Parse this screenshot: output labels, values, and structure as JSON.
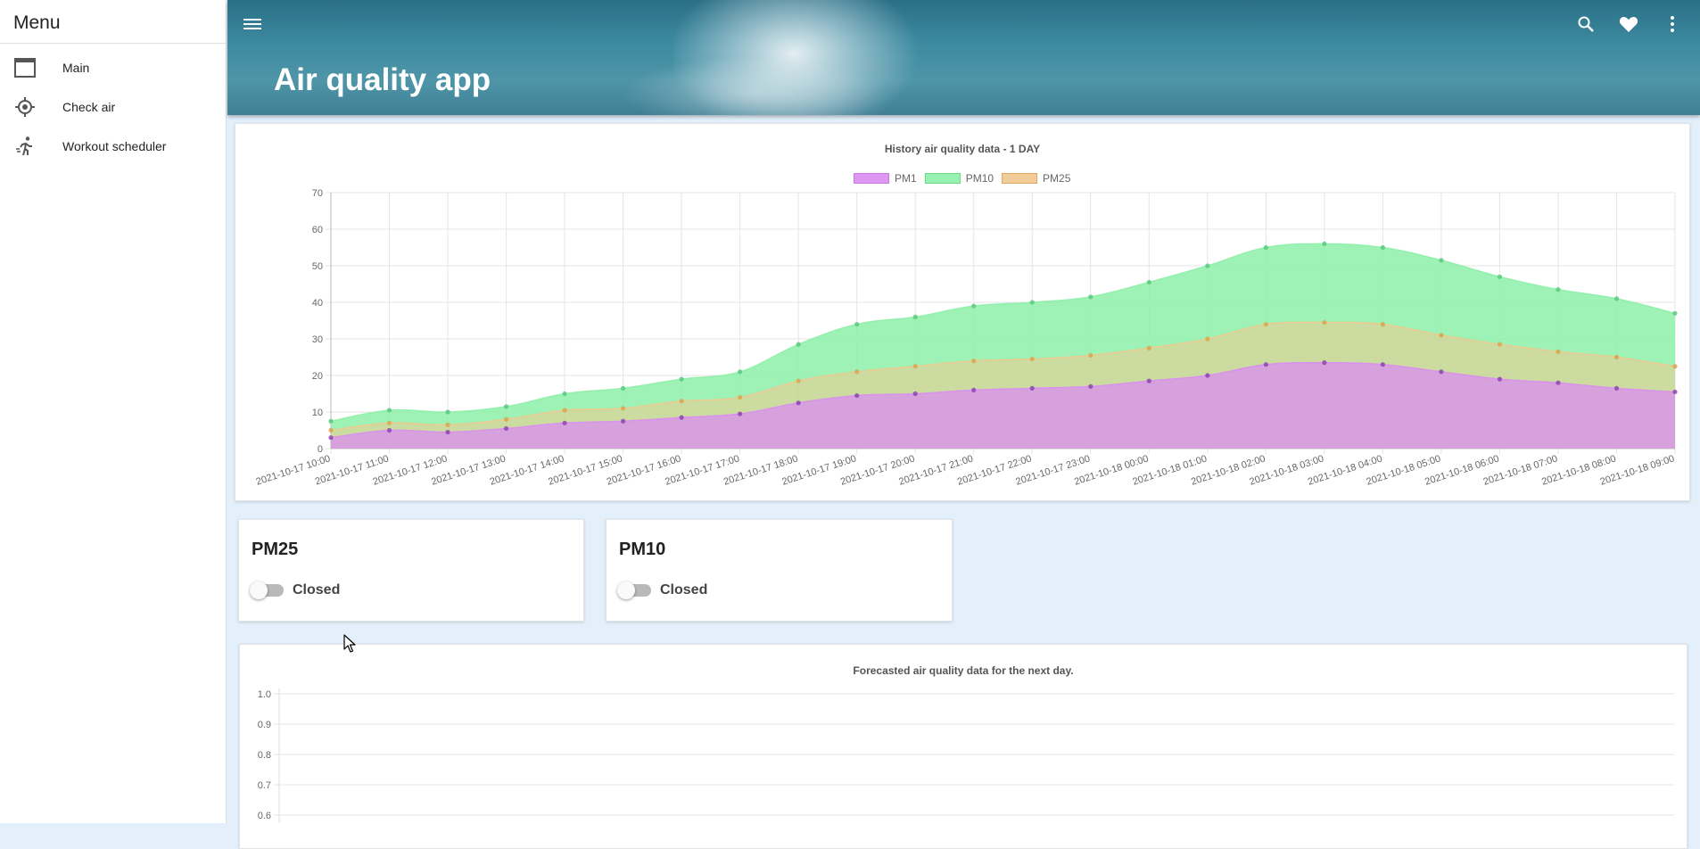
{
  "sidebar": {
    "title": "Menu",
    "items": [
      {
        "label": "Main",
        "icon": "window-icon"
      },
      {
        "label": "Check air",
        "icon": "crosshair-icon"
      },
      {
        "label": "Workout scheduler",
        "icon": "running-icon"
      }
    ]
  },
  "header": {
    "title": "Air quality app",
    "icons": [
      "menu-icon",
      "search-icon",
      "heart-icon",
      "more-vert-icon"
    ]
  },
  "controls": [
    {
      "title": "PM25",
      "state": "Closed"
    },
    {
      "title": "PM10",
      "state": "Closed"
    }
  ],
  "colors": {
    "pm1": "#d98ef0",
    "pm10": "#8ef0a8",
    "pm25": "#f0c88e"
  },
  "chart_data": [
    {
      "type": "area",
      "title": "History air quality data - 1 DAY",
      "legend_position": "top",
      "grid": true,
      "ylim": [
        0,
        70
      ],
      "yticks": [
        0,
        10,
        20,
        30,
        40,
        50,
        60,
        70
      ],
      "x": [
        "2021-10-17 10:00",
        "2021-10-17 11:00",
        "2021-10-17 12:00",
        "2021-10-17 13:00",
        "2021-10-17 14:00",
        "2021-10-17 15:00",
        "2021-10-17 16:00",
        "2021-10-17 17:00",
        "2021-10-17 18:00",
        "2021-10-17 19:00",
        "2021-10-17 20:00",
        "2021-10-17 21:00",
        "2021-10-17 22:00",
        "2021-10-17 23:00",
        "2021-10-18 00:00",
        "2021-10-18 01:00",
        "2021-10-18 02:00",
        "2021-10-18 03:00",
        "2021-10-18 04:00",
        "2021-10-18 05:00",
        "2021-10-18 06:00",
        "2021-10-18 07:00",
        "2021-10-18 08:00",
        "2021-10-18 09:00"
      ],
      "series": [
        {
          "name": "PM1",
          "values": [
            3,
            5,
            4.5,
            5.5,
            7,
            7.5,
            8.5,
            9.5,
            12.5,
            14.5,
            15,
            16,
            16.5,
            17,
            18.5,
            20,
            23,
            23.5,
            23,
            21,
            19,
            18,
            16.5,
            15.5
          ]
        },
        {
          "name": "PM10",
          "values": [
            7.5,
            10.5,
            10,
            11.5,
            15,
            16.5,
            19,
            21,
            28.5,
            34,
            36,
            39,
            40,
            41.5,
            45.5,
            50,
            55,
            56,
            55,
            51.5,
            47,
            43.5,
            41,
            37
          ]
        },
        {
          "name": "PM25",
          "values": [
            5,
            7,
            6.5,
            8,
            10.5,
            11,
            13,
            14,
            18.5,
            21,
            22.5,
            24,
            24.5,
            25.5,
            27.5,
            30,
            34,
            34.5,
            34,
            31,
            28.5,
            26.5,
            25,
            22.5
          ]
        }
      ]
    },
    {
      "type": "line",
      "title": "Forecasted air quality data for the next day.",
      "grid": true,
      "yticks": [
        1.0,
        0.9,
        0.8,
        0.7,
        0.6
      ],
      "ytick_labels": [
        "1.0",
        "0.9",
        "0.8",
        "0.7",
        "0.6"
      ],
      "series": []
    }
  ]
}
